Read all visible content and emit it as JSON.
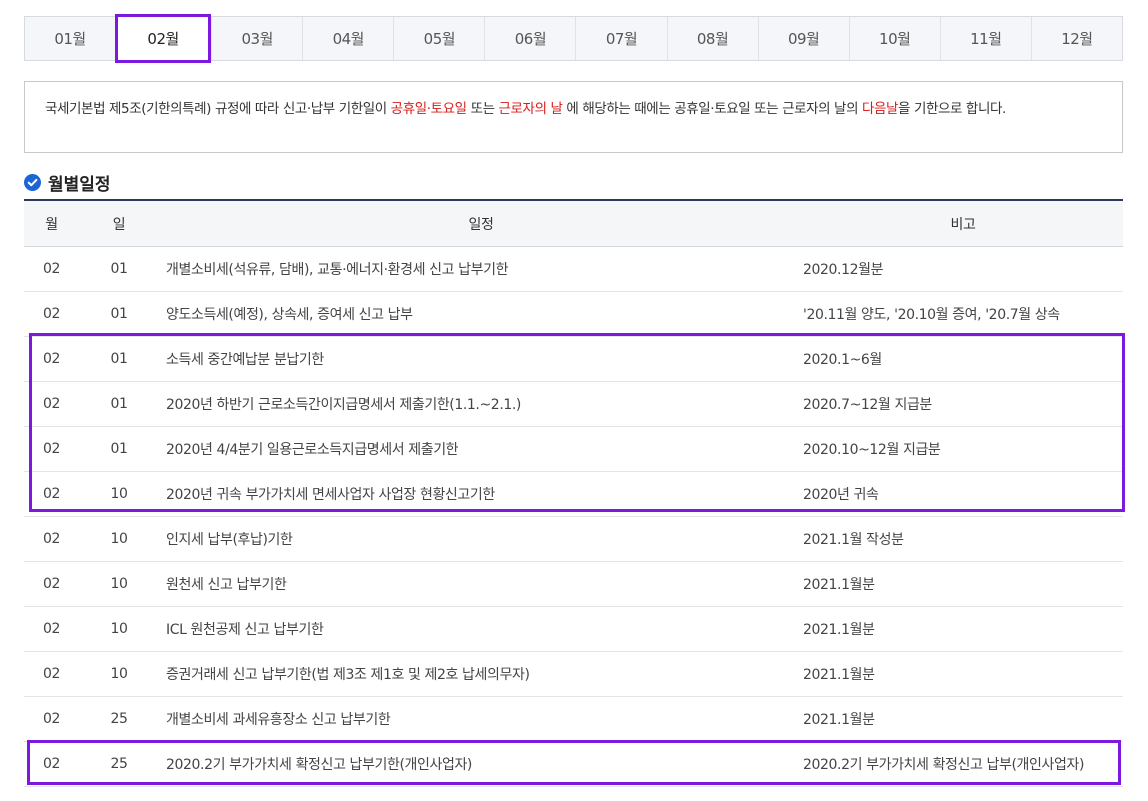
{
  "tabs": [
    {
      "label": "01월"
    },
    {
      "label": "02월"
    },
    {
      "label": "03월"
    },
    {
      "label": "04월"
    },
    {
      "label": "05월"
    },
    {
      "label": "06월"
    },
    {
      "label": "07월"
    },
    {
      "label": "08월"
    },
    {
      "label": "09월"
    },
    {
      "label": "10월"
    },
    {
      "label": "11월"
    },
    {
      "label": "12월"
    }
  ],
  "active_tab": "02월",
  "notice": {
    "part1": "국세기본법 제5조(기한의특례) 규정에 따라 신고·납부 기한일이 ",
    "red1": "공휴일·토요일",
    "part2": " 또는 ",
    "red2": "근로자의 날",
    "part3": " 에 해당하는 때에는 공휴일·토요일 또는 근로자의 날의 ",
    "red3": "다음날",
    "part4": "을 기한으로 합니다."
  },
  "section_title": "월별일정",
  "colors": {
    "accent": "#7b19e0",
    "red": "#d91b1b",
    "check": "#1a66d6"
  },
  "table": {
    "headers": {
      "month": "월",
      "day": "일",
      "schedule": "일정",
      "note": "비고"
    },
    "rows": [
      {
        "month": "02",
        "day": "01",
        "schedule": "개별소비세(석유류, 담배), 교통·에너지·환경세 신고 납부기한",
        "note": "2020.12월분"
      },
      {
        "month": "02",
        "day": "01",
        "schedule": "양도소득세(예정), 상속세, 증여세 신고 납부",
        "note": "'20.11월 양도, '20.10월 증여, '20.7월 상속"
      },
      {
        "month": "02",
        "day": "01",
        "schedule": "소득세 중간예납분 분납기한",
        "note": "2020.1~6월"
      },
      {
        "month": "02",
        "day": "01",
        "schedule": "2020년 하반기 근로소득간이지급명세서 제출기한(1.1.~2.1.)",
        "note": "2020.7~12월 지급분"
      },
      {
        "month": "02",
        "day": "01",
        "schedule": "2020년 4/4분기 일용근로소득지급명세서 제출기한",
        "note": "2020.10~12월 지급분"
      },
      {
        "month": "02",
        "day": "10",
        "schedule": "2020년 귀속 부가가치세 면세사업자 사업장 현황신고기한",
        "note": "2020년 귀속"
      },
      {
        "month": "02",
        "day": "10",
        "schedule": "인지세 납부(후납)기한",
        "note": "2021.1월 작성분"
      },
      {
        "month": "02",
        "day": "10",
        "schedule": "원천세 신고 납부기한",
        "note": "2021.1월분"
      },
      {
        "month": "02",
        "day": "10",
        "schedule": "ICL 원천공제 신고 납부기한",
        "note": "2021.1월분"
      },
      {
        "month": "02",
        "day": "10",
        "schedule": "증권거래세 신고 납부기한(법 제3조 제1호 및 제2호 납세의무자)",
        "note": "2021.1월분"
      },
      {
        "month": "02",
        "day": "25",
        "schedule": "개별소비세 과세유흥장소 신고 납부기한",
        "note": "2021.1월분"
      },
      {
        "month": "02",
        "day": "25",
        "schedule": "2020.2기 부가가치세 확정신고 납부기한(개인사업자)",
        "note": "2020.2기 부가가치세 확정신고 납부(개인사업자)"
      }
    ]
  }
}
